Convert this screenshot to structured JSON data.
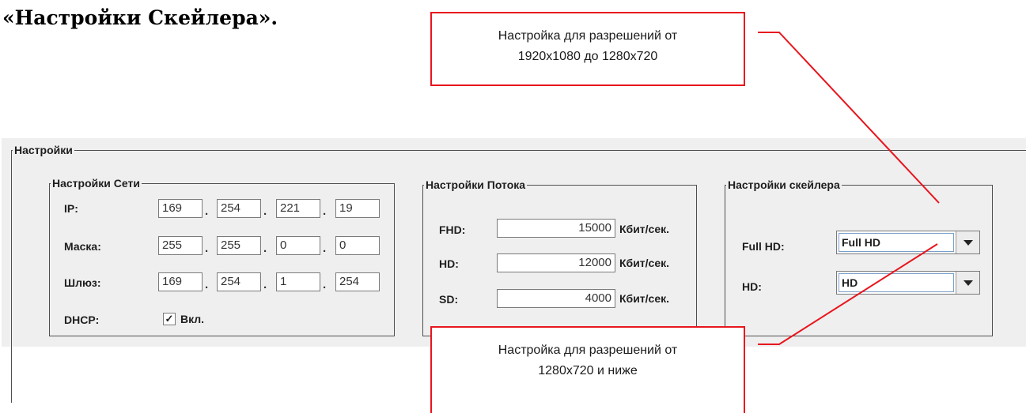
{
  "doc_title": "«Настройки Скейлера».",
  "panel": {
    "title": "Настройки",
    "network": {
      "title": "Настройки Сети",
      "ip_label": "IP:",
      "ip": [
        "169",
        "254",
        "221",
        "19"
      ],
      "mask_label": "Маска:",
      "mask": [
        "255",
        "255",
        "0",
        "0"
      ],
      "gateway_label": "Шлюз:",
      "gateway": [
        "169",
        "254",
        "1",
        "254"
      ],
      "dot": ".",
      "dhcp_label": "DHCP:",
      "dhcp_checkbox": "Вкл.",
      "dhcp_checked": true,
      "check_mark": "✓"
    },
    "stream": {
      "title": "Настройки Потока",
      "rows": [
        {
          "label": "FHD:",
          "value": "15000",
          "unit": "Кбит/сек."
        },
        {
          "label": "HD:",
          "value": "12000",
          "unit": "Кбит/сек."
        },
        {
          "label": "SD:",
          "value": "4000",
          "unit": "Кбит/сек."
        }
      ]
    },
    "scaler": {
      "title": "Настройки скейлера",
      "full_hd_label": "Full HD:",
      "full_hd_value": "Full HD",
      "hd_label": "HD:",
      "hd_value": "HD"
    }
  },
  "callouts": {
    "top": {
      "line1": "Настройка для разрешений от",
      "line2": "1920x1080 до 1280x720"
    },
    "bottom": {
      "line1": "Настройка для разрешений от",
      "line2": "1280x720 и ниже"
    }
  },
  "colors": {
    "callout_border": "#e8151d",
    "panel_bg": "#efefef",
    "combo_focus": "#7aa0c8"
  }
}
